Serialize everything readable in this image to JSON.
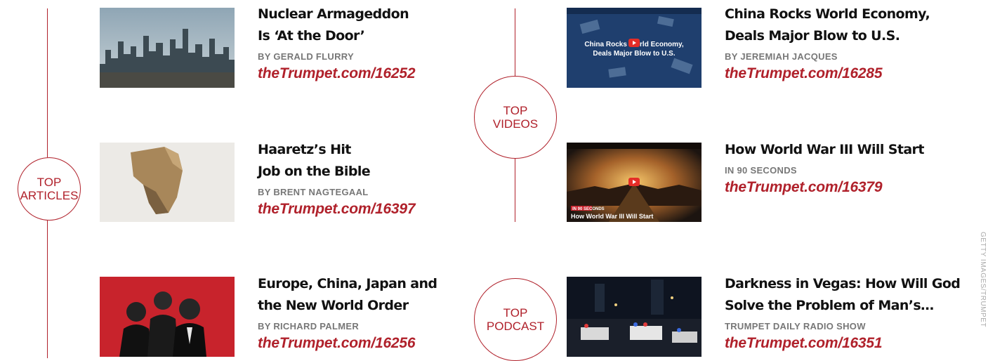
{
  "sections": {
    "articles_label": [
      "TOP",
      "ARTICLES"
    ],
    "videos_label": [
      "TOP",
      "VIDEOS"
    ],
    "podcast_label": [
      "TOP",
      "PODCAST"
    ]
  },
  "articles": [
    {
      "title_lines": [
        "Nuclear Armageddon",
        "Is ‘At the Door’"
      ],
      "byline": "BY GERALD FLURRY",
      "link": "theTrumpet.com/16252"
    },
    {
      "title_lines": [
        "Haaretz’s Hit",
        "Job on the Bible"
      ],
      "byline": "BY BRENT NAGTEGAAL",
      "link": "theTrumpet.com/16397"
    },
    {
      "title_lines": [
        "Europe, China, Japan and",
        "the New World Order"
      ],
      "byline": "BY RICHARD PALMER",
      "link": "theTrumpet.com/16256"
    }
  ],
  "videos": [
    {
      "title_lines": [
        "China Rocks World Economy,",
        "Deals Major Blow to U.S."
      ],
      "byline": "BY JEREMIAH JACQUES",
      "link": "theTrumpet.com/16285",
      "thumb_text": [
        "China Rocks World Economy,",
        "Deals Major Blow to U.S."
      ]
    },
    {
      "title_lines": [
        "How World War III Will Start"
      ],
      "byline": "IN 90 SECONDS",
      "link": "theTrumpet.com/16379",
      "thumb_text": [
        "IN 90 SECONDS",
        "How World War III Will Start"
      ]
    }
  ],
  "podcast": {
    "title_lines": [
      "Darkness in Vegas: How Will God",
      "Solve the Problem of Man’s…"
    ],
    "byline": "TRUMPET DAILY RADIO SHOW",
    "link": "theTrumpet.com/16351"
  },
  "photo_credit": "GETTY IMAGES/TRUMPET",
  "colors": {
    "accent": "#b0212b",
    "title": "#111111",
    "byline": "#777777"
  }
}
